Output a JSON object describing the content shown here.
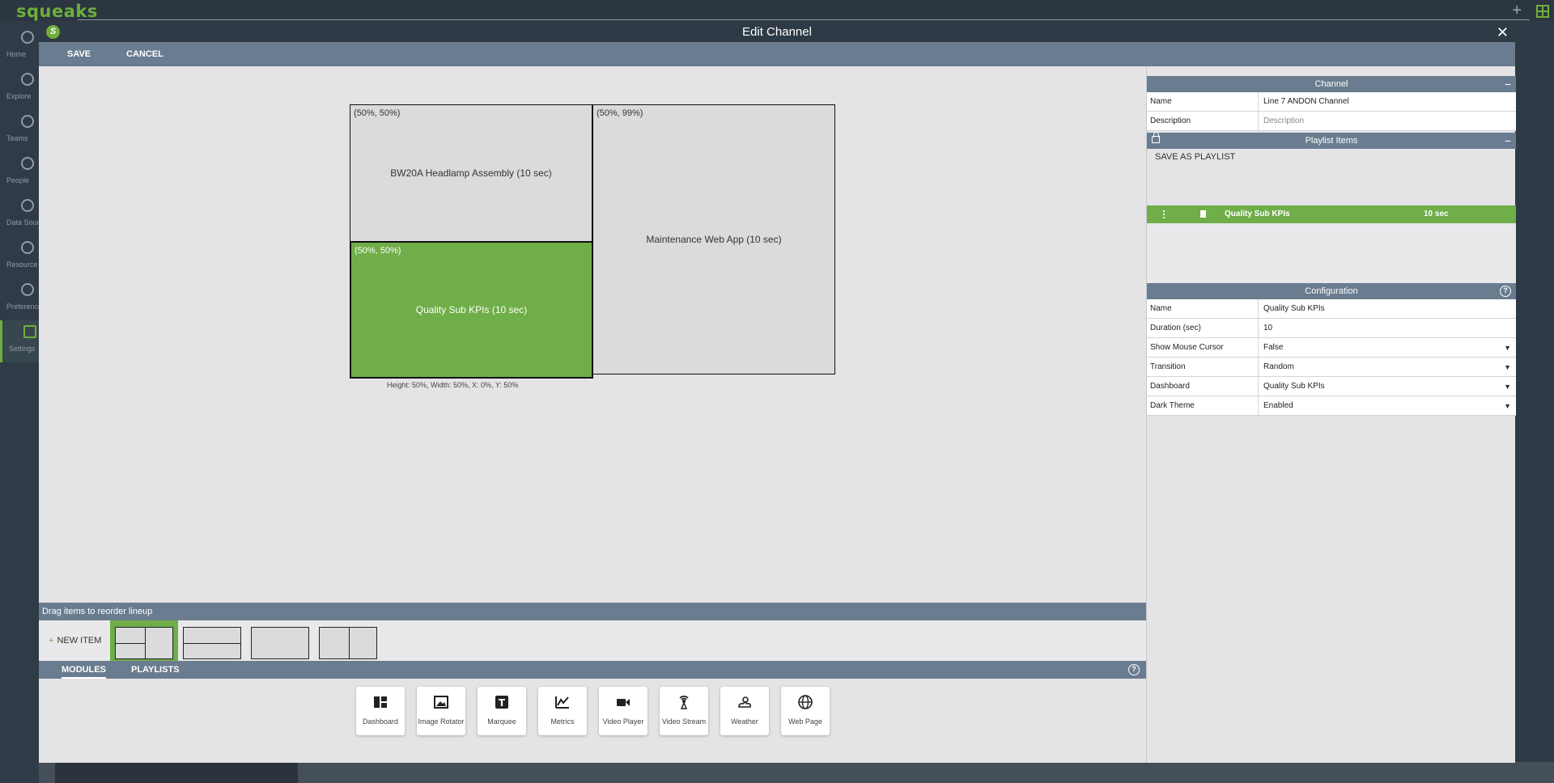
{
  "app": {
    "logo": "squeaks",
    "nav": [
      {
        "label": "Home"
      },
      {
        "label": "Explore"
      },
      {
        "label": "Teams"
      },
      {
        "label": "People"
      },
      {
        "label": "Data Sources"
      },
      {
        "label": "Resource Library"
      },
      {
        "label": "Preferences"
      },
      {
        "label": "Settings"
      }
    ]
  },
  "modal": {
    "title": "Edit Channel",
    "save_label": "SAVE",
    "cancel_label": "CANCEL",
    "close_glyph": "✕"
  },
  "canvas": {
    "tiles": [
      {
        "pos": "(50%, 50%)",
        "label": "BW20A Headlamp Assembly (10 sec)"
      },
      {
        "pos": "(50%, 99%)",
        "label": "Maintenance Web App (10 sec)"
      },
      {
        "pos": "(50%, 50%)",
        "label": "Quality Sub KPIs (10 sec)"
      }
    ],
    "dimensions": "Height: 50%, Width: 50%, X: 0%, Y: 50%"
  },
  "lineup": {
    "header": "Drag items to reorder lineup",
    "new_item": "NEW ITEM"
  },
  "tabs": {
    "modules": "MODULES",
    "playlists": "PLAYLISTS"
  },
  "modules": [
    {
      "label": "Dashboard",
      "icon": "dashboard-icon"
    },
    {
      "label": "Image Rotator",
      "icon": "image-icon"
    },
    {
      "label": "Marquee",
      "icon": "marquee-icon"
    },
    {
      "label": "Metrics",
      "icon": "metrics-icon"
    },
    {
      "label": "Video Player",
      "icon": "video-camera-icon"
    },
    {
      "label": "Video Stream",
      "icon": "broadcast-icon"
    },
    {
      "label": "Weather",
      "icon": "weather-icon"
    },
    {
      "label": "Web Page",
      "icon": "globe-icon"
    }
  ],
  "channel": {
    "header": "Channel",
    "name_key": "Name",
    "name_value": "Line 7 ANDON Channel",
    "desc_key": "Description",
    "desc_placeholder": "Description"
  },
  "playlist": {
    "header": "Playlist Items",
    "save_as": "SAVE AS PLAYLIST",
    "items": [
      {
        "name": "Quality Sub KPIs",
        "duration": "10 sec"
      }
    ]
  },
  "configuration": {
    "header": "Configuration",
    "rows": [
      {
        "key": "Name",
        "value": "Quality Sub KPIs",
        "dropdown": false
      },
      {
        "key": "Duration (sec)",
        "value": "10",
        "dropdown": false
      },
      {
        "key": "Show Mouse Cursor",
        "value": "False",
        "dropdown": true
      },
      {
        "key": "Transition",
        "value": "Random",
        "dropdown": true
      },
      {
        "key": "Dashboard",
        "value": "Quality Sub KPIs",
        "dropdown": true
      },
      {
        "key": "Dark Theme",
        "value": "Enabled",
        "dropdown": true
      }
    ]
  },
  "colors": {
    "accent": "#6fae48",
    "header": "#6a7c90",
    "titlebar": "#2e3a45"
  }
}
